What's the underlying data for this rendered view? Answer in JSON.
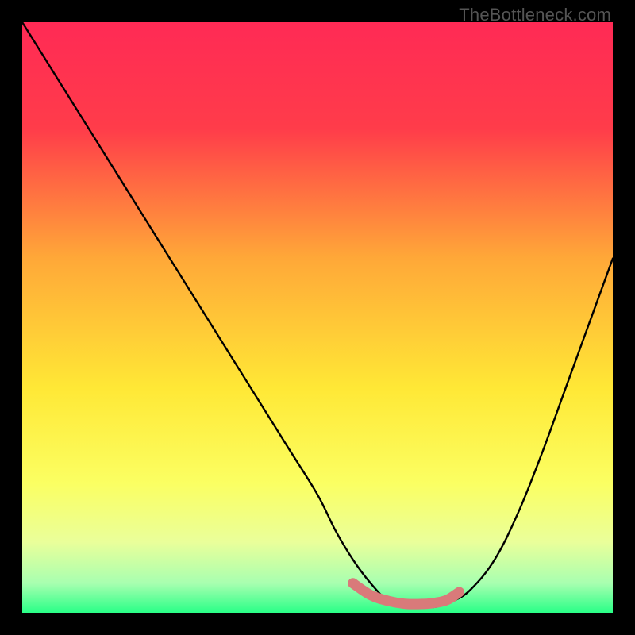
{
  "watermark": "TheBottleneck.com",
  "chart_data": {
    "type": "line",
    "title": "",
    "xlabel": "",
    "ylabel": "",
    "xlim": [
      0,
      100
    ],
    "ylim": [
      0,
      100
    ],
    "background_gradient": {
      "stops": [
        {
          "offset": 0,
          "color": "#ff2a55"
        },
        {
          "offset": 18,
          "color": "#ff3c4a"
        },
        {
          "offset": 40,
          "color": "#ffa838"
        },
        {
          "offset": 62,
          "color": "#ffe836"
        },
        {
          "offset": 78,
          "color": "#fbff62"
        },
        {
          "offset": 88,
          "color": "#eaff9a"
        },
        {
          "offset": 95,
          "color": "#a8ffb0"
        },
        {
          "offset": 100,
          "color": "#29ff87"
        }
      ]
    },
    "series": [
      {
        "name": "bottleneck-curve",
        "color": "#000000",
        "x": [
          0,
          5,
          10,
          15,
          20,
          25,
          30,
          35,
          40,
          45,
          50,
          53,
          56,
          59,
          62,
          65,
          68,
          70,
          73,
          76,
          80,
          84,
          88,
          92,
          96,
          100
        ],
        "y": [
          100,
          92,
          84,
          76,
          68,
          60,
          52,
          44,
          36,
          28,
          20,
          14,
          9,
          5,
          2,
          1,
          1,
          1,
          2,
          4,
          9,
          17,
          27,
          38,
          49,
          60
        ]
      }
    ],
    "highlight": {
      "name": "optimal-range",
      "color": "#d97a7a",
      "x": [
        56,
        59,
        62,
        65,
        68,
        70,
        72,
        74
      ],
      "y": [
        5,
        3,
        2,
        1.5,
        1.5,
        1.7,
        2.2,
        3.5
      ]
    }
  }
}
